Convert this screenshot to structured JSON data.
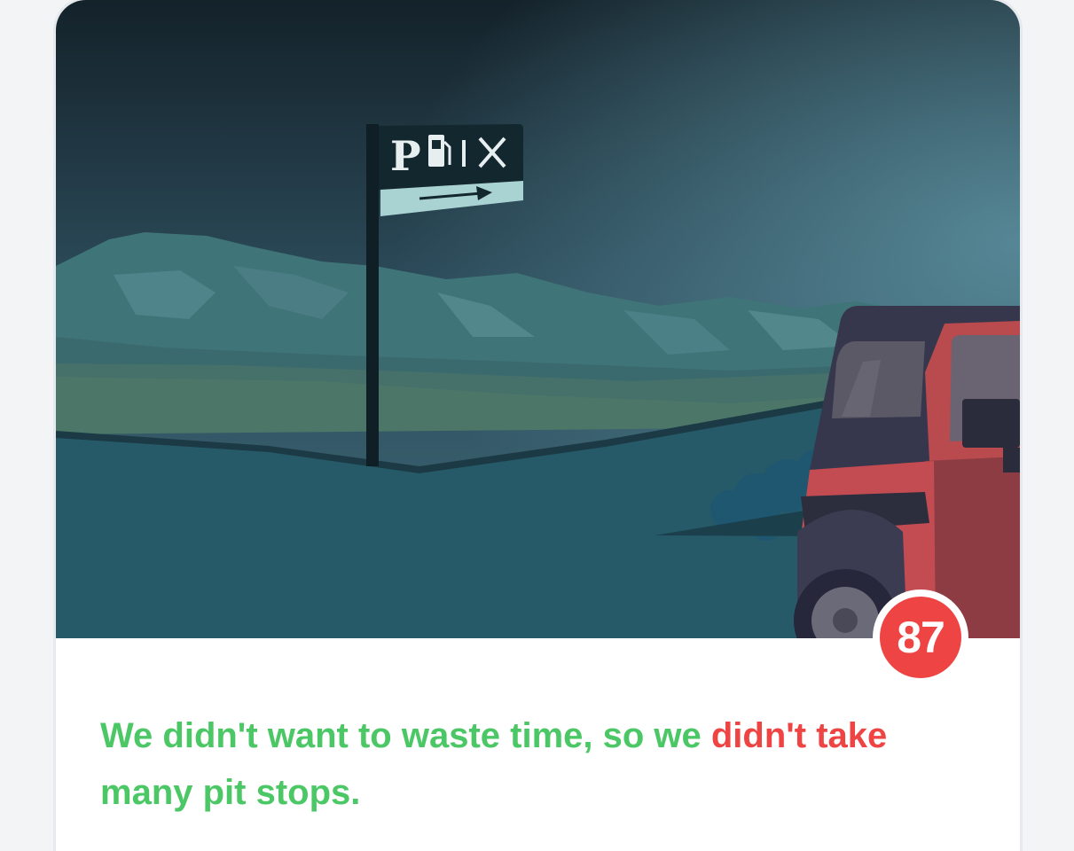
{
  "sign": {
    "letter": "P"
  },
  "score": {
    "value": "87",
    "color": "#ef4444"
  },
  "sentence": {
    "part1": "We didn't want to waste time, so we ",
    "highlight": "didn't take",
    "part2": " many pit stops.",
    "text_color": "#4cc766",
    "highlight_color": "#ef4444"
  }
}
